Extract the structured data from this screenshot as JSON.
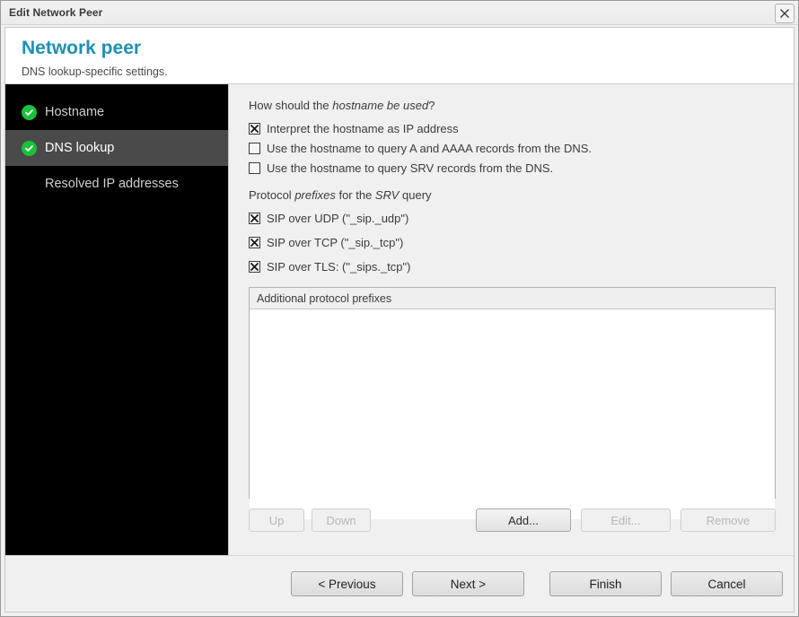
{
  "window": {
    "title": "Edit Network Peer",
    "close_icon": "close-icon"
  },
  "header": {
    "title": "Network peer",
    "subtitle": "DNS lookup-specific settings."
  },
  "sidebar": {
    "items": [
      {
        "label": "Hostname",
        "completed": true,
        "selected": false,
        "icon": "check-circle-icon"
      },
      {
        "label": "DNS lookup",
        "completed": true,
        "selected": true,
        "icon": "check-circle-icon"
      },
      {
        "label": "Resolved IP addresses",
        "completed": false,
        "selected": false,
        "icon": null
      }
    ]
  },
  "main": {
    "hostname_question": {
      "prefix": "How should the ",
      "emphasis": "hostname be used",
      "suffix": "?"
    },
    "hostname_options": [
      {
        "label": "Interpret the hostname as IP address",
        "checked": true
      },
      {
        "label": "Use the hostname to query A and AAAA records from the DNS.",
        "checked": false
      },
      {
        "label": "Use the hostname to query SRV records from the DNS.",
        "checked": false
      }
    ],
    "srv_question": {
      "prefix": "Protocol ",
      "emphasis1": "prefixes",
      "middle": " for the ",
      "emphasis2": "SRV",
      "suffix": " query"
    },
    "srv_options": [
      {
        "label": "SIP over UDP (\"_sip._udp\")",
        "checked": true
      },
      {
        "label": "SIP over TCP (\"_sip._tcp\")",
        "checked": true
      },
      {
        "label": "SIP over TLS: (\"_sips._tcp\")",
        "checked": true
      }
    ],
    "listbox": {
      "header": "Additional protocol prefixes",
      "rows": []
    },
    "list_actions": [
      {
        "label": "Up",
        "enabled": false
      },
      {
        "label": "Down",
        "enabled": false
      },
      {
        "label": "Add...",
        "enabled": true
      },
      {
        "label": "Edit...",
        "enabled": false
      },
      {
        "label": "Remove",
        "enabled": false
      }
    ]
  },
  "footer": {
    "buttons": [
      {
        "label": "< Previous",
        "enabled": true
      },
      {
        "label": "Next >",
        "enabled": true
      },
      {
        "label": "Finish",
        "enabled": true
      },
      {
        "label": "Cancel",
        "enabled": true
      }
    ]
  },
  "colors": {
    "accent": "#1f8fb5",
    "sidebar_bg": "#000000",
    "sidebar_selected": "#4a4a4a",
    "check_green": "#18c23a"
  }
}
